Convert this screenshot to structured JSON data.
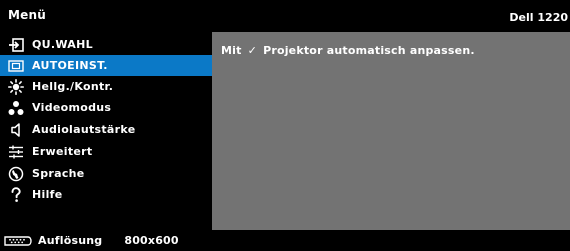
{
  "header": {
    "title": "Menü",
    "brand": "Dell 1220"
  },
  "sidebar": {
    "items": [
      {
        "label": "QU.WAHL",
        "icon": "input-source-icon"
      },
      {
        "label": "AUTOEINST.",
        "icon": "auto-adjust-icon",
        "selected": true
      },
      {
        "label": "Hellg./Kontr.",
        "icon": "brightness-icon"
      },
      {
        "label": "Videomodus",
        "icon": "video-mode-icon"
      },
      {
        "label": "Audiolautstärke",
        "icon": "speaker-icon"
      },
      {
        "label": "Erweitert",
        "icon": "advanced-settings-icon"
      },
      {
        "label": "Sprache",
        "icon": "language-globe-icon"
      },
      {
        "label": "Hilfe",
        "icon": "help-icon"
      }
    ]
  },
  "content": {
    "before_check": "Mit",
    "check_symbol": "✓",
    "after_check": "Projektor automatisch anpassen."
  },
  "footer": {
    "label": "Auflösung",
    "value": "800x600",
    "icon": "video-source-icon"
  },
  "colors": {
    "background": "#000000",
    "selected": "#0b79c7",
    "content_panel": "#737373",
    "text": "#ffffff"
  }
}
